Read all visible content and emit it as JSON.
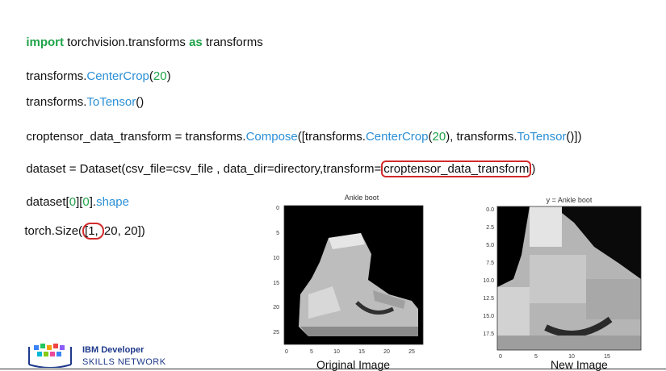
{
  "code": {
    "line1": {
      "kw1": "import",
      "mod": " torchvision.transforms ",
      "kw2": "as",
      "alias": " transforms"
    },
    "line2": {
      "obj": "transforms.",
      "fn": "CenterCrop",
      "open": "(",
      "num": "20",
      "close": ")"
    },
    "line3": {
      "obj": "transforms.",
      "fn": "ToTensor",
      "rest": "()"
    },
    "line4": {
      "pre": "croptensor_data_transform = transforms.",
      "fn1": "Compose",
      "mid1": "([transforms.",
      "fn2": "CenterCrop",
      "open": "(",
      "num": "20",
      "mid2": "), transforms.",
      "fn3": "ToTensor",
      "end": "()])"
    },
    "line5": {
      "pre": "dataset = Dataset(csv_file=csv_file , data_dir=directory,transform=",
      "hl": "croptensor_data_transform",
      "end": ")"
    },
    "line6": {
      "pre": "dataset[",
      "n1": "0",
      "mid": "][",
      "n2": "0",
      "end": "].",
      "fn": "shape"
    },
    "line7": {
      "pre": "torch.Size(",
      "hl": "[1, ",
      "rest": "20, 20])"
    }
  },
  "figures": {
    "left": {
      "title": "Ankle boot",
      "caption": "Original Image",
      "yticks": [
        "0",
        "5",
        "10",
        "15",
        "20",
        "25"
      ],
      "xticks": [
        "0",
        "5",
        "10",
        "15",
        "20",
        "25"
      ]
    },
    "right": {
      "title": "y = Ankle boot",
      "caption": "New Image",
      "yticks": [
        "0.0",
        "2.5",
        "5.0",
        "7.5",
        "10.0",
        "12.5",
        "15.0",
        "17.5"
      ],
      "xticks": [
        "0",
        "5",
        "10",
        "15"
      ]
    }
  },
  "logo": {
    "line1": "IBM Developer",
    "line2": "SKILLS NETWORK"
  }
}
